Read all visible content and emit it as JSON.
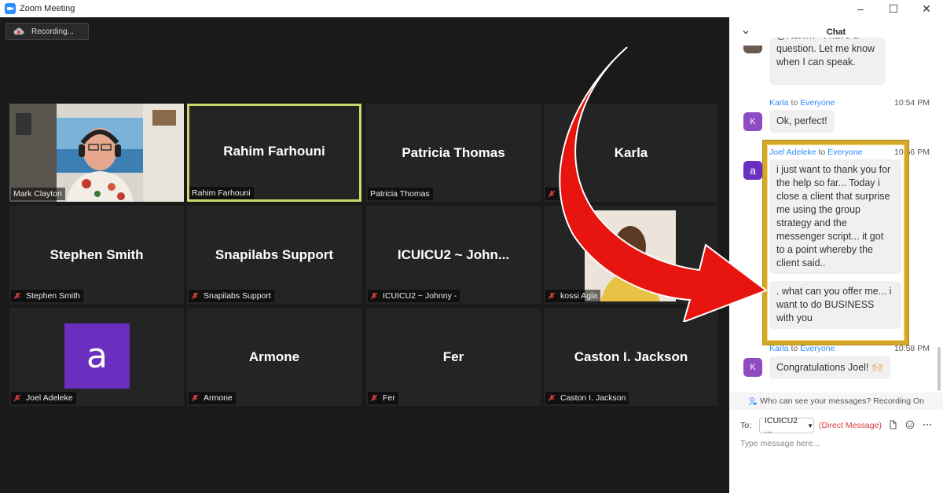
{
  "window": {
    "title": "Zoom Meeting",
    "controls": {
      "minimize": "–",
      "maximize": "☐",
      "close": "✕"
    }
  },
  "recording": {
    "label": "Recording..."
  },
  "tiles": [
    {
      "id": "mark",
      "display": "",
      "label": "Mark Clayton",
      "muted": false
    },
    {
      "id": "rahim",
      "display": "Rahim Farhouni",
      "label": "Rahim Farhouni",
      "muted": false,
      "active": true
    },
    {
      "id": "patricia",
      "display": "Patricia Thomas",
      "label": "Patricia Thomas",
      "muted": false
    },
    {
      "id": "karla",
      "display": "Karla",
      "label": "Karla",
      "muted": true
    },
    {
      "id": "stephen",
      "display": "Stephen Smith",
      "label": "Stephen Smith",
      "muted": true
    },
    {
      "id": "snapilabs",
      "display": "Snapilabs Support",
      "label": "Snapilabs Support",
      "muted": true
    },
    {
      "id": "icuicu2",
      "display": "ICUICU2 ~ John...",
      "label": "ICUICU2 ~ Johnny -",
      "muted": true
    },
    {
      "id": "kossi",
      "display": "",
      "label": "kossi Agla",
      "muted": true
    },
    {
      "id": "joel",
      "display": "a",
      "label": "Joel Adeleke",
      "muted": true
    },
    {
      "id": "armone",
      "display": "Armone",
      "label": "Armone",
      "muted": true
    },
    {
      "id": "fer",
      "display": "Fer",
      "label": "Fer",
      "muted": true
    },
    {
      "id": "caston",
      "display": "Caston I. Jackson",
      "label": "Caston I. Jackson",
      "muted": true
    }
  ],
  "chat": {
    "title": "Chat",
    "messages": [
      {
        "partial_text": "@Rahim - I have a question. Let me know when I can speak."
      },
      {
        "sender": "Karla",
        "to_word": "to",
        "recipient": "Everyone",
        "time": "10:54 PM",
        "avatar": "K",
        "text": "Ok, perfect!"
      },
      {
        "sender": "Joel Adeleke",
        "to_word": "to",
        "recipient": "Everyone",
        "time": "10:56 PM",
        "avatar": "a",
        "text": "i just want to thank you for the help so far...  Today i close a client that  surprise me using the group strategy and the messenger script... it got to a point whereby the client said..",
        "text2": ". what can you offer me... i want to do BUSINESS with you"
      },
      {
        "sender": "Karla",
        "to_word": "to",
        "recipient": "Everyone",
        "time": "10:58 PM",
        "avatar": "K",
        "text": "Congratulations Joel! 🙌🏻"
      }
    ],
    "visibility_text": "Who can see your messages? Recording On",
    "to_label": "To:",
    "to_value": "ICUICU2 ...",
    "direct_message": "(Direct Message)",
    "input_placeholder": "Type message here..."
  },
  "colors": {
    "accent": "#2d8cff",
    "active_border": "#c8d86a",
    "arrow": "#e8140f",
    "gold": "#d4a829",
    "avatar_purple": "#6a2fbf"
  }
}
